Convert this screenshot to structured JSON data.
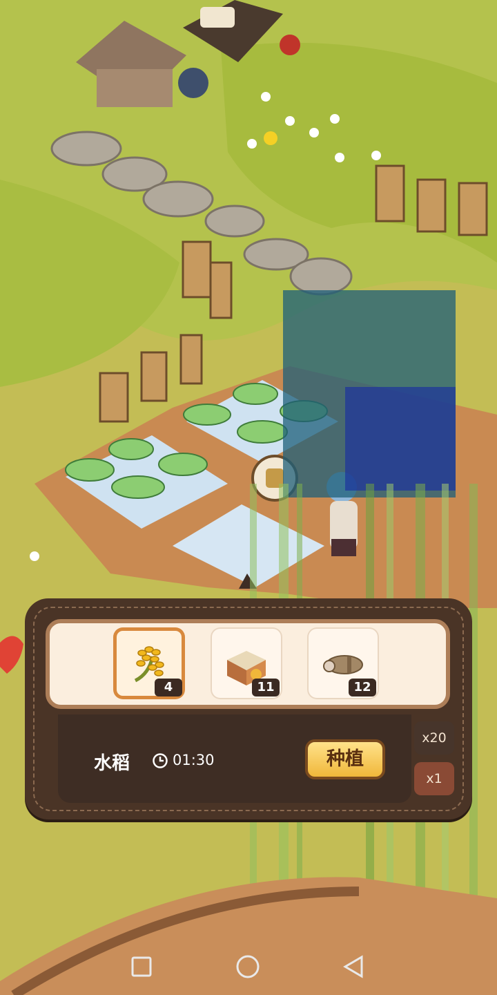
{
  "seed_tray": {
    "items": [
      {
        "name": "rice-seed",
        "icon": "rice-stalk-icon",
        "count": "4",
        "selected": true
      },
      {
        "name": "grain-sack",
        "icon": "grain-crate-icon",
        "count": "11",
        "selected": false
      },
      {
        "name": "sausage",
        "icon": "sausage-icon",
        "count": "12",
        "selected": false
      }
    ]
  },
  "crop_info": {
    "name": "水稻",
    "time": "01:30",
    "time_icon": "clock-icon"
  },
  "actions": {
    "plant_label": "种植",
    "multiplier_20": "x20",
    "multiplier_1": "x1"
  },
  "navbar": {
    "recent_icon": "square-icon",
    "home_icon": "circle-icon",
    "back_icon": "triangle-back-icon"
  },
  "colors": {
    "panel": "#4a3426",
    "tray": "#fbeede",
    "accent_button": "#f0b73a",
    "selected_border": "#d8893d"
  }
}
